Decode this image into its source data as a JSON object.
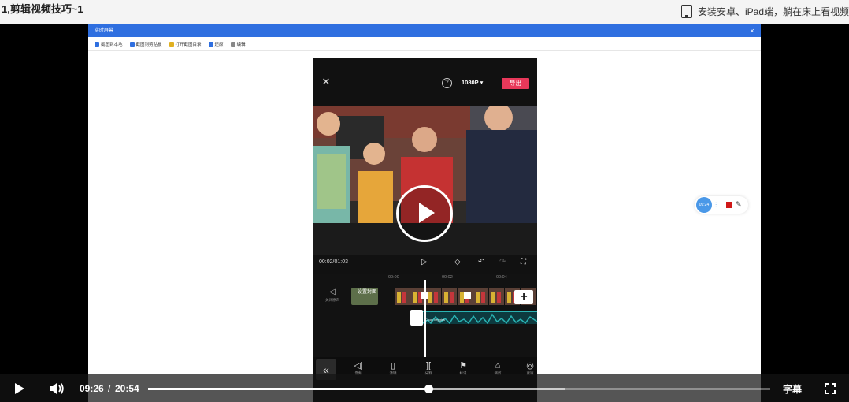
{
  "header": {
    "title": "1,剪辑视频技巧~1",
    "promo": "安装安卓、iPad端，躺在床上看视频"
  },
  "capture_window": {
    "title": "实时屏幕",
    "close": "×",
    "toolbar": [
      {
        "label": "截图到本地",
        "icon": "scissors-icon",
        "color": "#2f6fe0"
      },
      {
        "label": "截图到剪贴板",
        "icon": "scissors-icon",
        "color": "#2f6fe0"
      },
      {
        "label": "打开截图目录",
        "icon": "folder-icon",
        "color": "#e0b020"
      },
      {
        "label": "还原",
        "icon": "restore-icon",
        "color": "#2f6fe0"
      },
      {
        "label": "编辑",
        "icon": "edit-icon",
        "color": "#888888"
      }
    ]
  },
  "phone": {
    "close": "✕",
    "help": "?",
    "resolution": "1080P ▾",
    "export": "导出",
    "time": "00:02/01:03",
    "ticks": [
      "00:00",
      "00:02",
      "00:04"
    ],
    "mute_label": "关闭原声",
    "cover_label": "设置封面",
    "audio_name": "Chop Veggies",
    "tools": [
      {
        "icon": "◁|",
        "label": "音频"
      },
      {
        "icon": "▯",
        "label": "滤镜"
      },
      {
        "icon": "][",
        "label": "分割"
      },
      {
        "icon": "⚑",
        "label": "标记"
      },
      {
        "icon": "⌂",
        "label": "裁剪"
      },
      {
        "icon": "◎",
        "label": "变速"
      }
    ]
  },
  "recorder": {
    "time": "09:24"
  },
  "player": {
    "current_time": "09:26",
    "separator": "/",
    "duration": "20:54",
    "played_fraction": 0.45,
    "buffered_fraction": 0.67,
    "subtitle_label": "字幕"
  },
  "colors": {
    "accent": "#2f6fe0",
    "export": "#e8385a",
    "record_stop": "#d01818",
    "waveform": "#2ab3b3"
  }
}
